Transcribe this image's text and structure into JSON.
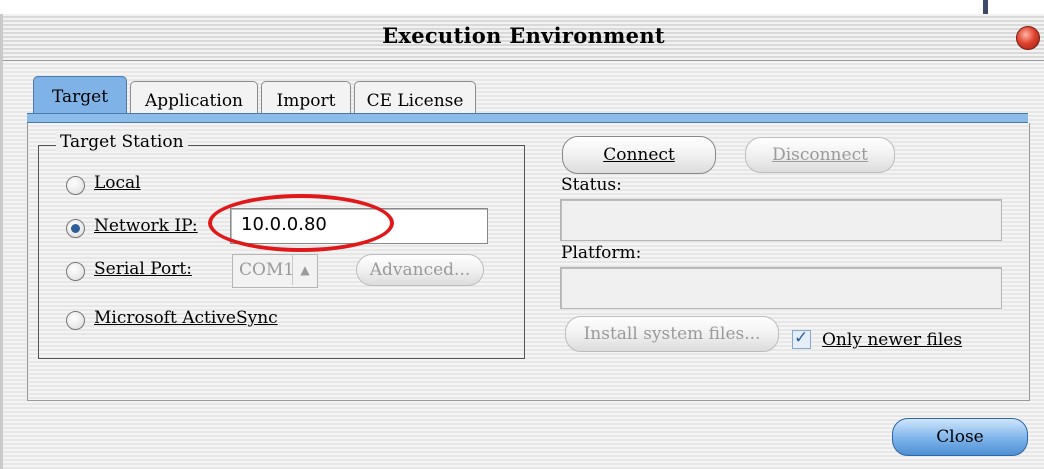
{
  "window": {
    "title": "Execution Environment"
  },
  "tabs": [
    {
      "label": "Target",
      "active": true
    },
    {
      "label": "Application",
      "active": false
    },
    {
      "label": "Import",
      "active": false
    },
    {
      "label": "CE License",
      "active": false
    }
  ],
  "target_station": {
    "legend": "Target Station",
    "options": {
      "local": "Local",
      "network_ip": "Network IP:",
      "serial_port": "Serial Port:",
      "activesync": "Microsoft ActiveSync"
    },
    "selected": "network_ip",
    "network_ip_value": "10.0.0.80",
    "serial_port_value": "COM1",
    "advanced_label": "Advanced..."
  },
  "connection": {
    "connect_label": "Connect",
    "disconnect_label": "Disconnect",
    "status_label": "Status:",
    "status_value": "",
    "platform_label": "Platform:",
    "platform_value": "",
    "install_label": "Install system files...",
    "only_newer_label": "Only newer files",
    "only_newer_checked": true
  },
  "footer": {
    "close_label": "Close"
  },
  "colors": {
    "active_tab": "#7fb2e6",
    "highlight_ellipse": "#e0181a",
    "close_button": "#7cb3ea"
  }
}
